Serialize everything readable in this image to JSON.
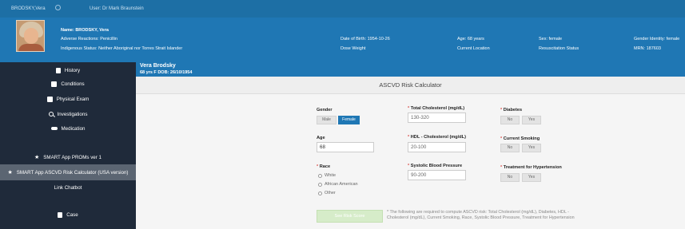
{
  "topbar": {
    "patient": "BRODSKY,Vera",
    "user": "User: Dr Mark Braunstein"
  },
  "banner": {
    "name": "Name: BRODSKY, Vera",
    "adverse": "Adverse Reactions: Penicillin",
    "indigenous": "Indigenous Status: Neither Aboriginal nor Torres Strait Islander",
    "dob": "Date of Birth: 1954-10-26",
    "age": "Age: 68 years",
    "sex": "Sex: female",
    "gender": "Gender Identity: female",
    "dose_weight": "Dose Weight",
    "location": "Current Location",
    "resus": "Resuscitation Status",
    "mrn": "MRN: 187603"
  },
  "sidebar": {
    "history": "History",
    "conditions": "Conditions",
    "physical": "Physical Exam",
    "investigations": "Investigations",
    "medication": "Medication",
    "proms": "SMART App PROMs ver 1",
    "ascvd": "SMART App ASCVD Risk Calculator (USA version)",
    "chatbot": "Link Chatbot",
    "case": "Case"
  },
  "patient_bar": {
    "name": "Vera Brodsky",
    "info": "68 yrs  F  DOB: 26/10/1954"
  },
  "calc": {
    "title": "ASCVD Risk Calculator",
    "gender_label": "Gender",
    "male": "Male",
    "female": "Female",
    "age_label": "Age",
    "age_value": "68",
    "race_label": "Race",
    "race_white": "White",
    "race_aa": "African American",
    "race_other": "Other",
    "total_chol_label": "Total Cholesterol (mg/dL)",
    "total_chol_ph": "130-320",
    "hdl_label": "HDL - Cholesterol (mg/dL)",
    "hdl_ph": "20-100",
    "sbp_label": "Systolic Blood Pressure",
    "sbp_ph": "90-200",
    "diabetes_label": "Diabetes",
    "smoking_label": "Current Smoking",
    "htn_label": "Treatment for Hypertension",
    "no": "No",
    "yes": "Yes",
    "req_mark": "*",
    "see_score": "See Risk Score",
    "note": "* The following are required to compute ASCVD risk: Total Cholesterol (mg/dL), Diabetes, HDL - Cholesterol (mg/dL), Current Smoking, Race, Systolic Blood Pressure, Treatment for Hypertension"
  }
}
